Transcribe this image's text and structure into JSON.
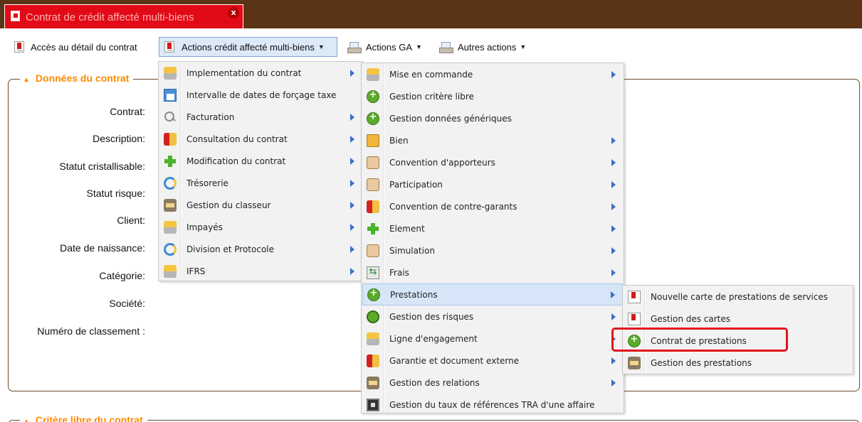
{
  "tab": {
    "title": "Contrat de crédit affecté multi-biens",
    "close_label": "x"
  },
  "toolbar": {
    "items": [
      {
        "label": "Accès au détail du contrat",
        "icon": "document-icon"
      },
      {
        "label": "Actions crédit affecté multi-biens",
        "icon": "document-icon",
        "caret": "▼"
      },
      {
        "label": "Actions GA",
        "icon": "tray-icon",
        "caret": "▼"
      },
      {
        "label": "Autres actions",
        "icon": "tray-icon",
        "caret": "▼"
      }
    ]
  },
  "section": {
    "title": "Données du contrat",
    "toggle": "▲",
    "fields": [
      "Contrat:",
      "Description:",
      "Statut cristallisable:",
      "Statut risque:",
      "Client:",
      "Date de naissance:",
      "Catégorie:",
      "Société:",
      "Numéro de classement :"
    ]
  },
  "section2": {
    "title": "Critère libre du contrat",
    "toggle": "▲"
  },
  "menu1": {
    "items": [
      {
        "label": "Implementation du contrat",
        "icon": "people-icon",
        "submenu": true
      },
      {
        "label": "Intervalle de dates de forçage taxe",
        "icon": "calendar-icon",
        "submenu": false
      },
      {
        "label": "Facturation",
        "icon": "magnifier-icon",
        "submenu": true
      },
      {
        "label": "Consultation du contrat",
        "icon": "red-people-icon",
        "submenu": true
      },
      {
        "label": "Modification du contrat",
        "icon": "green-plus-icon",
        "submenu": true
      },
      {
        "label": "Trésorerie",
        "icon": "refresh-icon",
        "submenu": true
      },
      {
        "label": "Gestion du classeur",
        "icon": "tray-icon",
        "submenu": true
      },
      {
        "label": "Impayés",
        "icon": "people-icon",
        "submenu": true
      },
      {
        "label": "Division et Protocole",
        "icon": "refresh-icon",
        "submenu": true
      },
      {
        "label": "IFRS",
        "icon": "people-icon",
        "submenu": true
      }
    ]
  },
  "menu2": {
    "items": [
      {
        "label": "Mise en commande",
        "icon": "people-icon",
        "submenu": true
      },
      {
        "label": "Gestion critère libre",
        "icon": "green-circle-plus-icon",
        "submenu": false
      },
      {
        "label": "Gestion données génériques",
        "icon": "green-circle-plus-icon",
        "submenu": false
      },
      {
        "label": "Bien",
        "icon": "house-icon",
        "submenu": true
      },
      {
        "label": "Convention d'apporteurs",
        "icon": "hand-icon",
        "submenu": true
      },
      {
        "label": "Participation",
        "icon": "hand-icon",
        "submenu": true
      },
      {
        "label": "Convention de contre-garants",
        "icon": "red-people-icon",
        "submenu": true
      },
      {
        "label": "Element",
        "icon": "green-plus-icon",
        "submenu": true
      },
      {
        "label": "Simulation",
        "icon": "hand-icon",
        "submenu": true
      },
      {
        "label": "Frais",
        "icon": "arrows-icon",
        "submenu": true
      },
      {
        "label": "Prestations",
        "icon": "green-circle-plus-icon",
        "submenu": true,
        "highlighted": true
      },
      {
        "label": "Gestion des risques",
        "icon": "risk-icon",
        "submenu": true
      },
      {
        "label": "Ligne d'engagement",
        "icon": "people-icon",
        "submenu": true
      },
      {
        "label": "Garantie et document externe",
        "icon": "red-people-icon",
        "submenu": true
      },
      {
        "label": "Gestion des relations",
        "icon": "tray-icon",
        "submenu": true
      },
      {
        "label": "Gestion du taux de références TRA d'une affaire",
        "icon": "screen-icon",
        "submenu": false
      }
    ]
  },
  "menu3": {
    "items": [
      {
        "label": "Nouvelle carte de prestations de services",
        "icon": "document-icon"
      },
      {
        "label": "Gestion des cartes",
        "icon": "document-icon"
      },
      {
        "label": "Contrat de prestations",
        "icon": "green-circle-plus-icon",
        "emphasized": true
      },
      {
        "label": "Gestion des prestations",
        "icon": "tray-icon"
      }
    ]
  },
  "colors": {
    "tabbar": "#5a3415",
    "tab": "#e20a16",
    "legend": "#ff8a00",
    "highlight_box": "#e3141b",
    "menu_bg": "#f2f2f2"
  }
}
